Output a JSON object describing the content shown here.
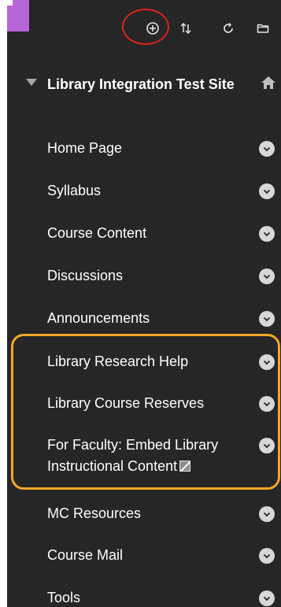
{
  "toolbar": {
    "icons": [
      "add-circle-icon",
      "sort-arrows-icon",
      "refresh-icon",
      "folder-icon"
    ]
  },
  "course": {
    "title": "Library Integration Test Site"
  },
  "menu": {
    "items": [
      {
        "label": "Home Page"
      },
      {
        "label": "Syllabus"
      },
      {
        "label": "Course Content"
      },
      {
        "label": "Discussions"
      },
      {
        "label": "Announcements"
      },
      {
        "label": "Library Research Help"
      },
      {
        "label": "Library Course Reserves"
      },
      {
        "label": "For Faculty: Embed Library Instructional Content"
      },
      {
        "label": "MC Resources"
      },
      {
        "label": "Course Mail"
      },
      {
        "label": "Tools"
      }
    ]
  },
  "colors": {
    "panel_background": "#262626",
    "corner_accent": "#b765d6",
    "highlight_red": "#e0221b",
    "highlight_orange": "#f5a623",
    "chevron_circle": "#d7d7d7"
  }
}
